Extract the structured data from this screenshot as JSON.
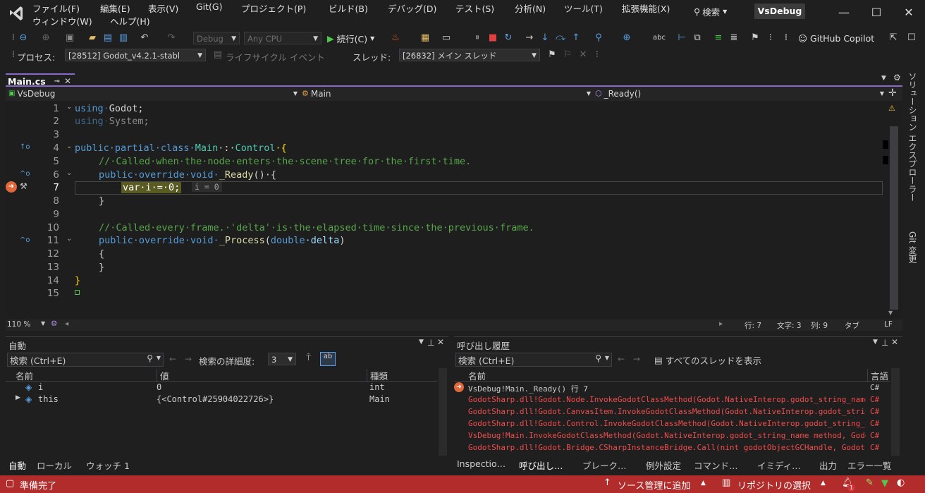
{
  "menu": [
    "ファイル(F)",
    "編集(E)",
    "表示(V)",
    "Git(G)",
    "プロジェクト(P)",
    "ビルド(B)",
    "デバッグ(D)",
    "テスト(S)",
    "分析(N)",
    "ツール(T)",
    "拡張機能(X)",
    "ウィンドウ(W)",
    "ヘルプ(H)"
  ],
  "search_label": "検索",
  "solution_name": "VsDebug",
  "toolbar": {
    "config": "Debug",
    "platform": "Any CPU",
    "continue_label": "続行(C)",
    "copilot_label": "GitHub Copilot"
  },
  "debug_location": {
    "process_label": "プロセス:",
    "process_value": "[28512] Godot_v4.2.1-stabl",
    "lifecycle_label": "ライフサイクル イベント",
    "thread_label": "スレッド:",
    "thread_value": "[26832] メイン スレッド"
  },
  "tab": {
    "file_name": "Main.cs"
  },
  "navbar": {
    "project": "VsDebug",
    "class": "Main",
    "member": "_Ready()"
  },
  "editor": {
    "line_numbers": [
      "1",
      "2",
      "3",
      "4",
      "5",
      "6",
      "7",
      "8",
      "9",
      "10",
      "11",
      "12",
      "13",
      "14",
      "15"
    ],
    "lines": {
      "l1_kw": "using",
      "l1_rest": "Godot;",
      "l2_kw": "using",
      "l2_rest": "System;",
      "l4_kw": "public·partial·class·",
      "l4_name": "Main",
      "l4_sep": "·:·",
      "l4_type": "Control",
      "l4_end": "·{",
      "l5_cm": "//·Called·when·the·node·enters·the·scene·tree·for·the·first·time.",
      "l6_kw": "public·override·void·",
      "l6_name": "_Ready",
      "l6_end": "()·{",
      "l7_code": "var·i·=·0;",
      "l7_hint": "i = 0",
      "l8": "}",
      "l10_cm": "//·Called·every·frame.·'delta'·is·the·elapsed·time·since·the·previous·frame.",
      "l11_kw": "public·override·void·",
      "l11_name": "_Process",
      "l11_paren": "(",
      "l11_kw2": "double",
      "l11_param": "·delta",
      "l11_end": ")",
      "l12": "{",
      "l13": "}",
      "l14": "}"
    },
    "zoom": "110 %",
    "status": {
      "line": "行: 7",
      "char": "文字: 3",
      "col": "列: 9",
      "tab": "タブ",
      "eol": "LF"
    }
  },
  "right_tabs": [
    "ソリューション エクスプローラー",
    "Git 変更"
  ],
  "autos": {
    "title": "自動",
    "search_placeholder": "検索 (Ctrl+E)",
    "depth_label": "検索の詳細度:",
    "depth_value": "3",
    "columns": [
      "名前",
      "値",
      "種類"
    ],
    "rows": [
      {
        "name": "i",
        "value": "0",
        "type": "int"
      },
      {
        "name": "this",
        "value": "{<Control#25904022726>}",
        "type": "Main"
      }
    ],
    "tabs": [
      "自動",
      "ローカル",
      "ウォッチ 1"
    ]
  },
  "callstack": {
    "title": "呼び出し履歴",
    "search_placeholder": "検索 (Ctrl+E)",
    "show_threads": "すべてのスレッドを表示",
    "columns": [
      "名前",
      "言語"
    ],
    "rows": [
      {
        "name": "VsDebug!Main._Ready() 行 7",
        "lang": "C#"
      },
      {
        "name": "GodotSharp.dll!Godot.Node.InvokeGodotClassMethod(Godot.NativeInterop.godot_string_name meth...",
        "lang": "C#"
      },
      {
        "name": "GodotSharp.dll!Godot.CanvasItem.InvokeGodotClassMethod(Godot.NativeInterop.godot_string_nam...",
        "lang": "C#"
      },
      {
        "name": "GodotSharp.dll!Godot.Control.InvokeGodotClassMethod(Godot.NativeInterop.godot_string_name m...",
        "lang": "C#"
      },
      {
        "name": "VsDebug!Main.InvokeGodotClassMethod(Godot.NativeInterop.godot_string_name method, Godot.Nat...",
        "lang": "C#"
      },
      {
        "name": "GodotSharp.dll!Godot.Bridge.CSharpInstanceBridge.Call(nint godotObjectGCHandle, Godot.Nativ...",
        "lang": "C#"
      }
    ],
    "tabs": [
      "Inspectio…",
      "呼び出し…",
      "ブレーク…",
      "例外設定",
      "コマンド…",
      "イミディ…",
      "出力",
      "エラー一覧"
    ]
  },
  "statusbar": {
    "ready": "準備完了",
    "source_control": "ソース管理に追加",
    "repo_select": "リポジトリの選択",
    "notification_count": "1"
  },
  "colors": {
    "accent": "#8a68c8",
    "status_bg": "#b22c2c",
    "error_text": "#f14c4c"
  }
}
